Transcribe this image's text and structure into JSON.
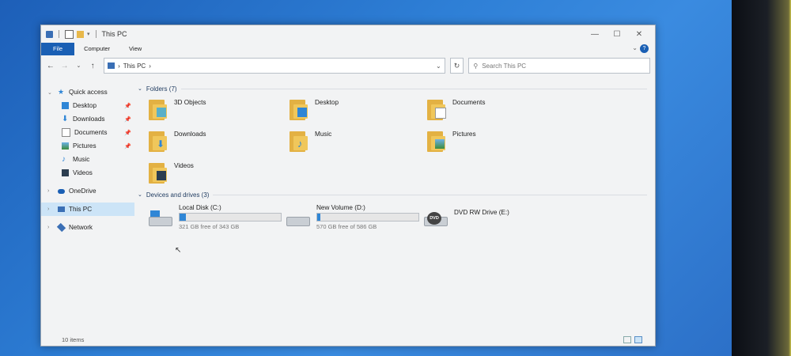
{
  "window": {
    "title": "This PC"
  },
  "ribbon": {
    "tabs": [
      "File",
      "Computer",
      "View"
    ],
    "help": "?"
  },
  "address": {
    "path_item": "This PC",
    "search_placeholder": "Search This PC"
  },
  "nav": {
    "quick_access": "Quick access",
    "quick_items": [
      "Desktop",
      "Downloads",
      "Documents",
      "Pictures",
      "Music",
      "Videos"
    ],
    "onedrive": "OneDrive",
    "this_pc": "This PC",
    "network": "Network"
  },
  "folders": {
    "header": "Folders (7)",
    "items": [
      "3D Objects",
      "Desktop",
      "Documents",
      "Downloads",
      "Music",
      "Pictures",
      "Videos"
    ]
  },
  "drives": {
    "header": "Devices and drives (3)",
    "items": [
      {
        "name": "Local Disk (C:)",
        "free": "321 GB free of 343 GB",
        "used_fraction": 0.06
      },
      {
        "name": "New Volume (D:)",
        "free": "570 GB free of 586 GB",
        "used_fraction": 0.03
      },
      {
        "name": "DVD RW Drive (E:)",
        "dvd_label": "DVD"
      }
    ]
  },
  "status": {
    "items_count": "10 items"
  },
  "colors": {
    "accent": "#1a5fb4",
    "folder": "#e3b143",
    "drive_fill": "#2f86d6"
  }
}
